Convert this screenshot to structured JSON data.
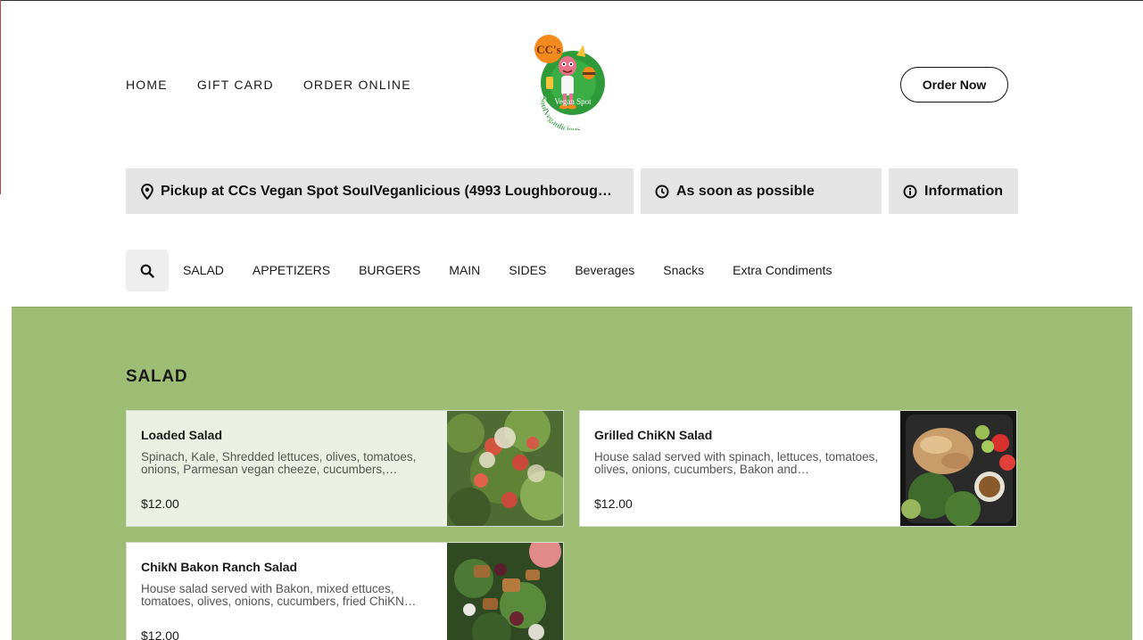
{
  "header": {
    "nav": [
      "HOME",
      "GIFT CARD",
      "ORDER ONLINE"
    ],
    "logo": {
      "badge": "CC's",
      "ring_text_top": "Vegan Spot",
      "ring_text_bottom": "SoulVeganlicious",
      "colors": {
        "green": "#2f9a3a",
        "orange": "#f28a1e",
        "pink": "#e8728b"
      }
    },
    "order_now_label": "Order Now"
  },
  "info_bar": {
    "pickup": {
      "icon": "location-pin-icon",
      "text": "Pickup at CCs Vegan Spot SoulVeganlicious (4993 Loughborough…"
    },
    "time": {
      "icon": "clock-icon",
      "text": "As soon as possible"
    },
    "information": {
      "icon": "info-icon",
      "text": "Information"
    }
  },
  "categories": {
    "search_icon": "search-icon",
    "items": [
      "SALAD",
      "APPETIZERS",
      "BURGERS",
      "MAIN",
      "SIDES",
      "Beverages",
      "Snacks",
      "Extra Condiments"
    ]
  },
  "menu": {
    "section_title": "SALAD",
    "background_color": "#9dbd74",
    "items": [
      {
        "name": "Loaded Salad",
        "description": "Spinach, Kale, Shredded lettuces, olives, tomatoes, onions, Parmesan vegan cheeze, cucumbers,…",
        "price": "$12.00"
      },
      {
        "name": "Grilled ChiKN Salad",
        "description": "House salad served with spinach, lettuces, tomatoes, olives, onions, cucumbers, Bakon and…",
        "price": "$12.00"
      },
      {
        "name": "ChikN Bakon Ranch Salad",
        "description": "House salad served with Bakon, mixed ettuces, tomatoes, olives, onions, cucumbers, fried ChiKN…",
        "price": "$12.00"
      }
    ]
  }
}
